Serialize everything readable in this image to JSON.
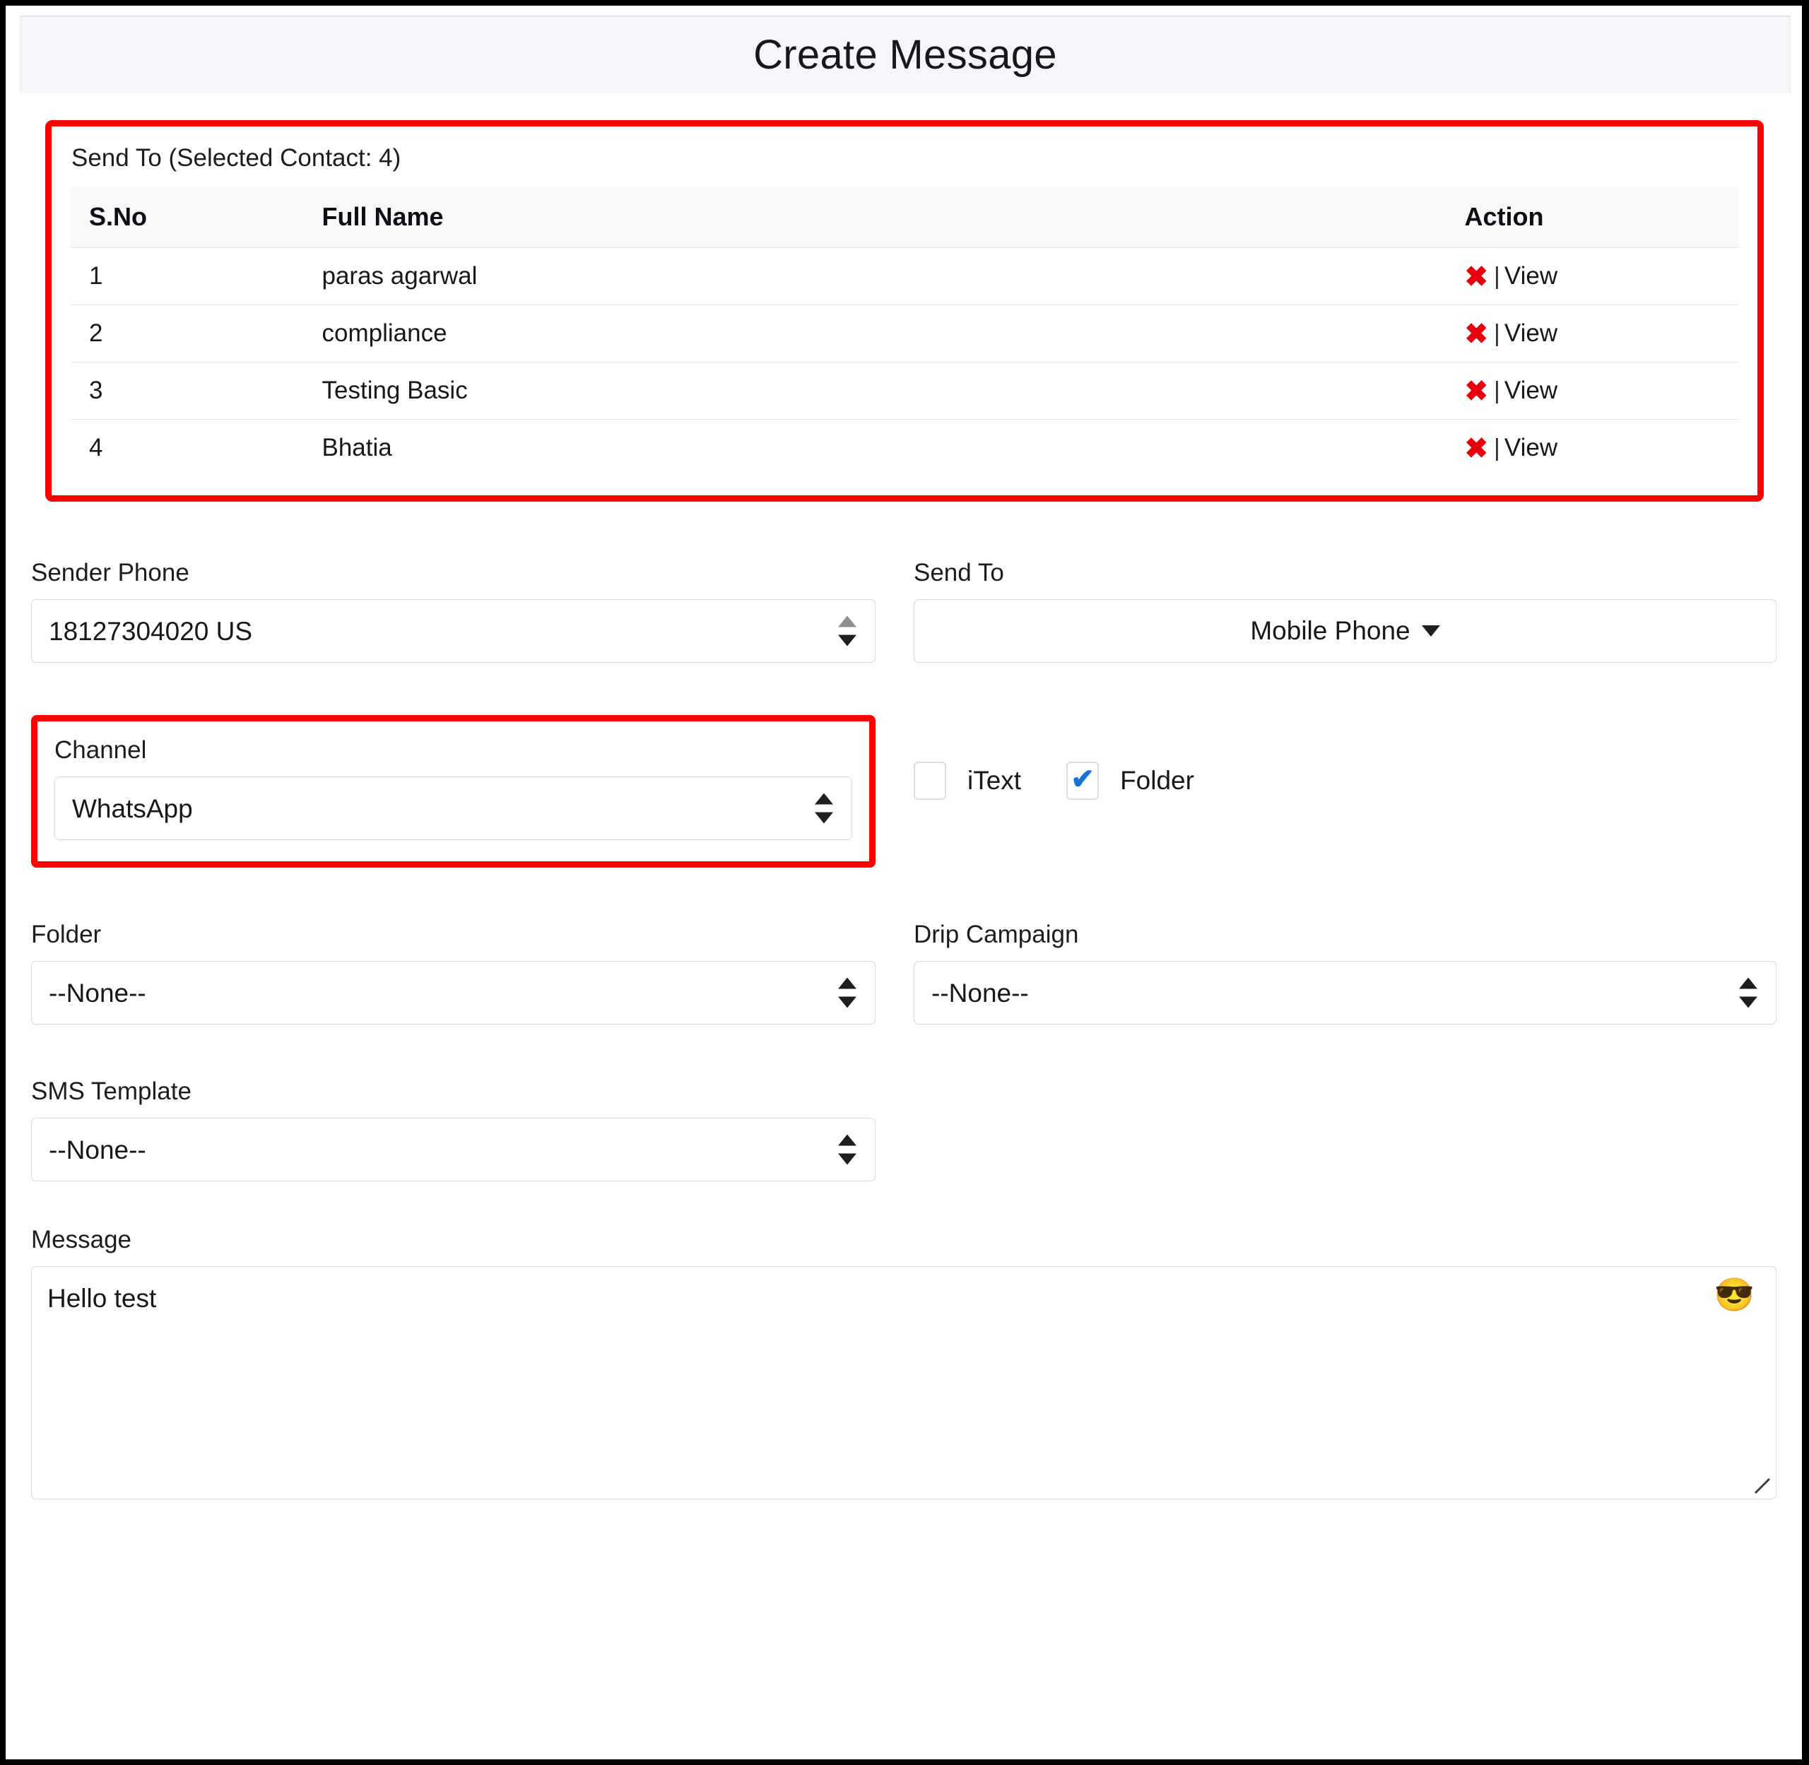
{
  "window": {
    "title": "Create Message"
  },
  "contacts_panel": {
    "caption": "Send To (Selected Contact: 4)",
    "columns": [
      "S.No",
      "Full Name",
      "Action"
    ],
    "rows": [
      {
        "sno": "1",
        "full_name": "paras agarwal",
        "delete_icon": "x-icon",
        "separator": "|",
        "view_label": "View"
      },
      {
        "sno": "2",
        "full_name": "compliance",
        "delete_icon": "x-icon",
        "separator": "|",
        "view_label": "View"
      },
      {
        "sno": "3",
        "full_name": "Testing Basic",
        "delete_icon": "x-icon",
        "separator": "|",
        "view_label": "View"
      },
      {
        "sno": "4",
        "full_name": "Bhatia",
        "delete_icon": "x-icon",
        "separator": "|",
        "view_label": "View"
      }
    ]
  },
  "form": {
    "sender_phone": {
      "label": "Sender Phone",
      "value": "18127304020 US"
    },
    "send_to": {
      "label": "Send To",
      "value": "Mobile Phone"
    },
    "channel": {
      "label": "Channel",
      "value": "WhatsApp"
    },
    "checkboxes": [
      {
        "label": "iText",
        "checked": "false",
        "mark": ""
      },
      {
        "label": "Folder",
        "checked": "true",
        "mark": "✔"
      }
    ],
    "folder": {
      "label": "Folder",
      "value": "--None--"
    },
    "drip_campaign": {
      "label": "Drip Campaign",
      "value": "--None--"
    },
    "sms_template": {
      "label": "SMS Template",
      "value": "--None--"
    },
    "message": {
      "label": "Message",
      "value": "Hello test",
      "emoji_icon": "😎"
    }
  },
  "colors": {
    "highlight": "#ff0000",
    "delete": "#e8000d",
    "check": "#1a73d4",
    "header_bg": "#f4f6fa"
  }
}
